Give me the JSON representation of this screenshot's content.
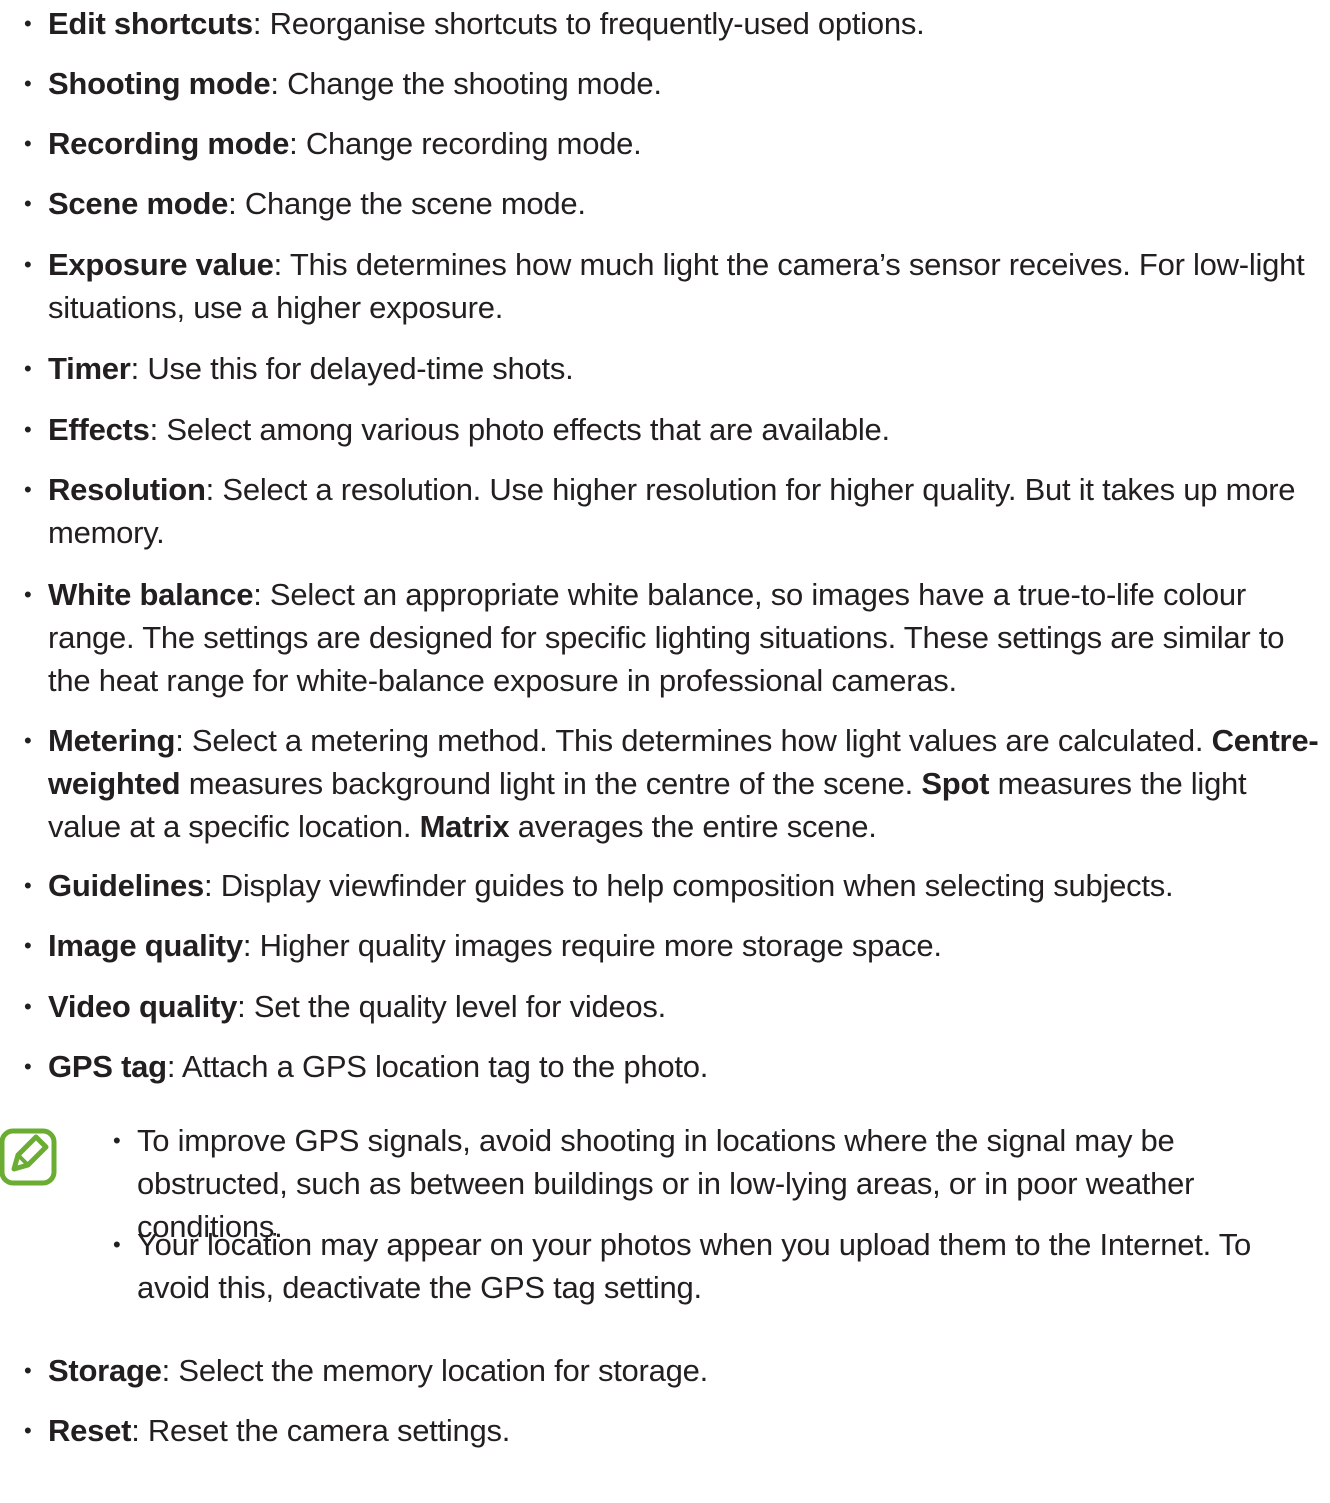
{
  "items": [
    {
      "bold": "Edit shortcuts",
      "rest": ": Reorganise shortcuts to frequently-used options."
    },
    {
      "bold": "Shooting mode",
      "rest": ": Change the shooting mode."
    },
    {
      "bold": "Recording mode",
      "rest": ": Change recording mode."
    },
    {
      "bold": "Scene mode",
      "rest": ": Change the scene mode."
    },
    {
      "bold": "Exposure value",
      "rest": ": This determines how much light the camera’s sensor receives. For low-light situations, use a higher exposure."
    },
    {
      "bold": "Timer",
      "rest": ": Use this for delayed-time shots."
    },
    {
      "bold": "Effects",
      "rest": ": Select among various photo effects that are available."
    },
    {
      "bold": "Resolution",
      "rest": ": Select a resolution. Use higher resolution for higher quality. But it takes up more memory."
    },
    {
      "bold": "White balance",
      "rest": ": Select an appropriate white balance, so images have a true-to-life colour range. The settings are designed for specific lighting situations. These settings are similar to the heat range for white-balance exposure in professional cameras."
    },
    {
      "bold": "Guidelines",
      "rest": ": Display viewfinder guides to help composition when selecting subjects."
    },
    {
      "bold": "Image quality",
      "rest": ": Higher quality images require more storage space."
    },
    {
      "bold": "Video quality",
      "rest": ": Set the quality level for videos."
    },
    {
      "bold": "GPS tag",
      "rest": ": Attach a GPS location tag to the photo."
    },
    {
      "bold": "Storage",
      "rest": ": Select the memory location for storage."
    },
    {
      "bold": "Reset",
      "rest": ": Reset the camera settings."
    }
  ],
  "metering": {
    "bold1": "Metering",
    "text1": ": Select a metering method. This determines how light values are calculated. ",
    "bold2": "Centre-weighted",
    "text2": " measures background light in the centre of the scene. ",
    "bold3": "Spot",
    "text3": " measures the light value at a specific location. ",
    "bold4": "Matrix",
    "text4": " averages the entire scene."
  },
  "notes": [
    "To improve GPS signals, avoid shooting in locations where the signal may be obstructed, such as between buildings or in low-lying areas, or in poor weather conditions.",
    "Your location may appear on your photos when you upload them to the Internet. To avoid this, deactivate the GPS tag setting."
  ],
  "bullet_glyph": "•",
  "note_icon": "note-pencil-icon",
  "colors": {
    "text": "#231f20",
    "note_icon": "#6aad32"
  }
}
